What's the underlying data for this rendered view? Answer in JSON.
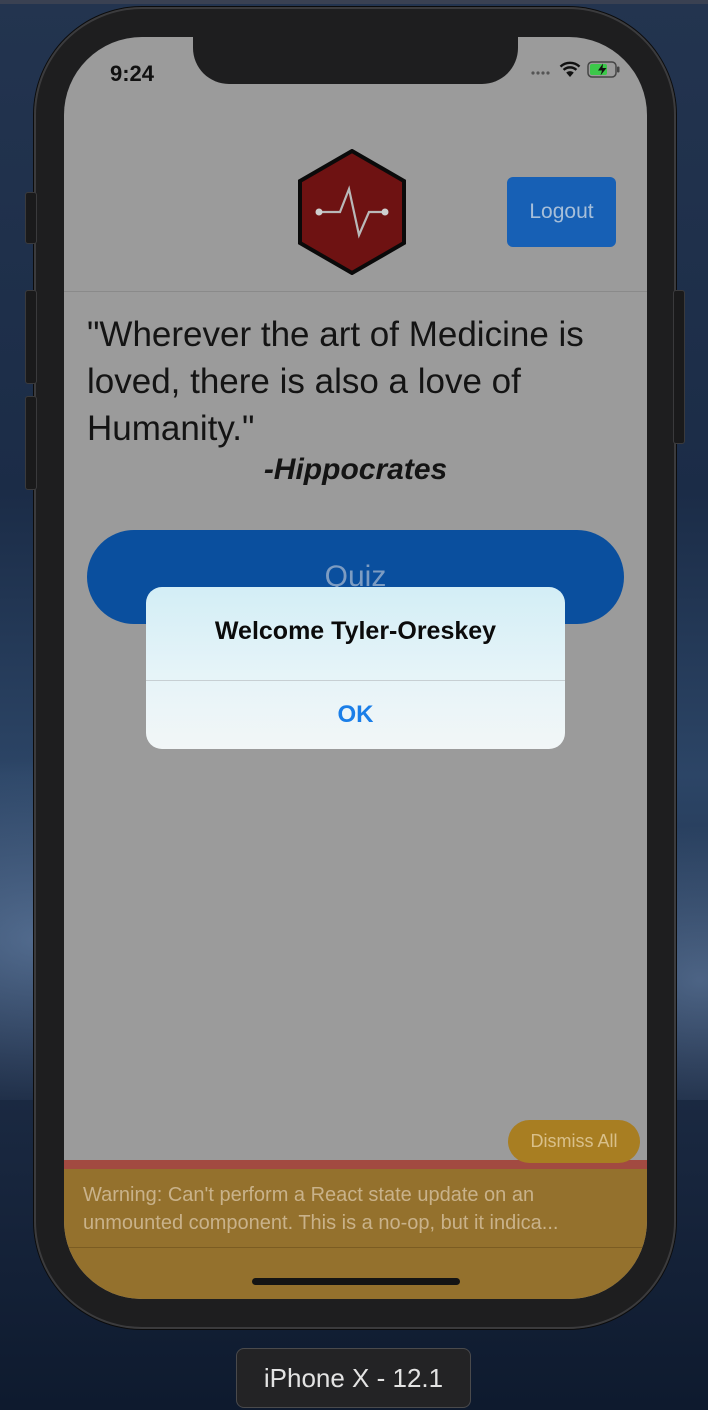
{
  "status_bar": {
    "time": "9:24"
  },
  "header": {
    "logout_label": "Logout",
    "logo_icon": "heartbeat-hexagon-logo",
    "logo_color": "#6e1212"
  },
  "quote": {
    "text": "\"Wherever the art of Medicine is loved, there is also a love of Humanity.\"",
    "author": "-Hippocrates"
  },
  "quiz_button": {
    "label": "Quiz"
  },
  "alert": {
    "title": "Welcome Tyler-Oreskey",
    "ok_label": "OK"
  },
  "warning": {
    "dismiss_label": "Dismiss All",
    "line1": "Warning: Can't perform a React state update on an",
    "line2": "unmounted component. This is a no-op, but it indica..."
  },
  "simulator": {
    "device_label": "iPhone X - 12.1"
  },
  "colors": {
    "primary_blue": "#1760b5",
    "warning_yellow": "#94712d",
    "error_red": "#a24a41",
    "alert_ok_blue": "#1a7ee8"
  }
}
